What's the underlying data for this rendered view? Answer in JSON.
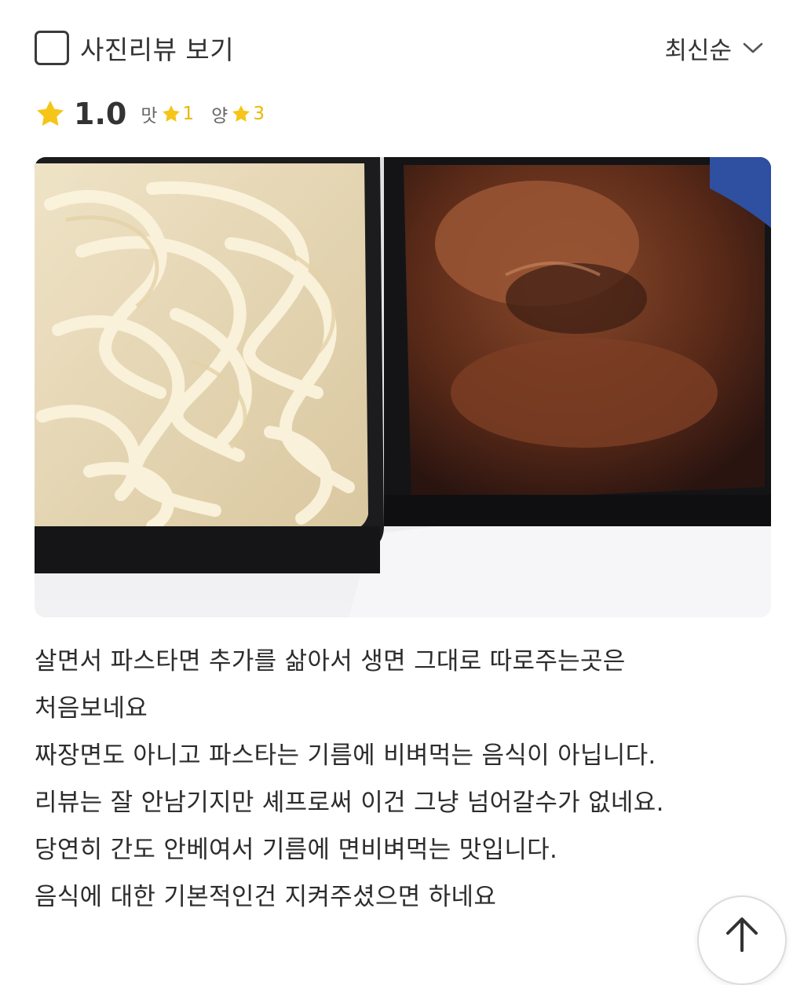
{
  "filter": {
    "photo_review_label": "사진리뷰 보기",
    "checked": false
  },
  "sort": {
    "label": "최신순"
  },
  "rating": {
    "overall": "1.0",
    "taste_label": "맛",
    "taste_value": "1",
    "quantity_label": "양",
    "quantity_value": "3",
    "star_color": "#f5c518"
  },
  "photo": {
    "description_icon": "food-photo"
  },
  "review": {
    "lines": [
      "살면서 파스타면 추가를 삶아서 생면 그대로 따로주는곳은",
      "처음보네요",
      "짜장면도 아니고 파스타는 기름에 비벼먹는 음식이 아닙니다.",
      "리뷰는 잘 안남기지만 셰프로써 이건 그냥 넘어갈수가 없네요.",
      "당연히 간도 안베여서 기름에 면비벼먹는 맛입니다.",
      "음식에 대한 기본적인건 지켜주셨으면 하네요"
    ]
  }
}
